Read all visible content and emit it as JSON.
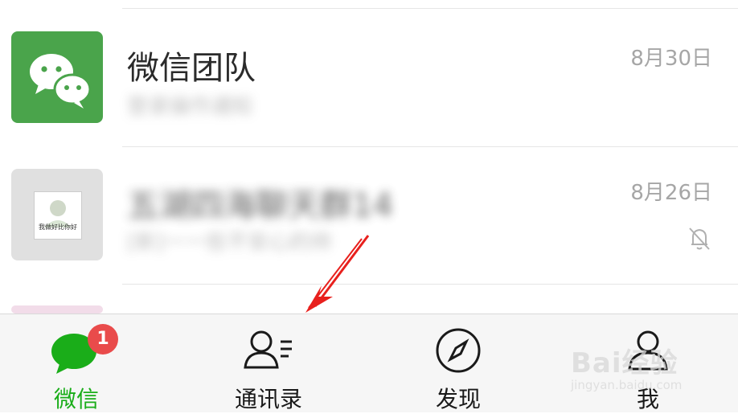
{
  "chats": [
    {
      "name": "微信团队",
      "preview": "登录操作通知",
      "date": "8月30日",
      "avatar": "wechat-logo-icon"
    },
    {
      "name": "五湖四海聊天群14",
      "preview": "[新]一一些不安心的帅",
      "date": "8月26日",
      "avatar": "group-avatar",
      "avatar_text": "我做好比你好",
      "muted": true
    },
    {
      "avatar": "partial-avatar"
    }
  ],
  "tabs": [
    {
      "label": "微信",
      "icon": "chat-bubbles-icon",
      "badge": "1",
      "active": true
    },
    {
      "label": "通讯录",
      "icon": "contacts-icon"
    },
    {
      "label": "发现",
      "icon": "compass-icon"
    },
    {
      "label": "我",
      "icon": "person-icon"
    }
  ],
  "watermark": {
    "text": "Bai经验",
    "sub": "jingyan.baidu.com"
  },
  "colors": {
    "accent": "#1aad19",
    "badge": "#e94b4b",
    "arrow": "#e8201d",
    "avatar_green": "#4aa44b"
  }
}
